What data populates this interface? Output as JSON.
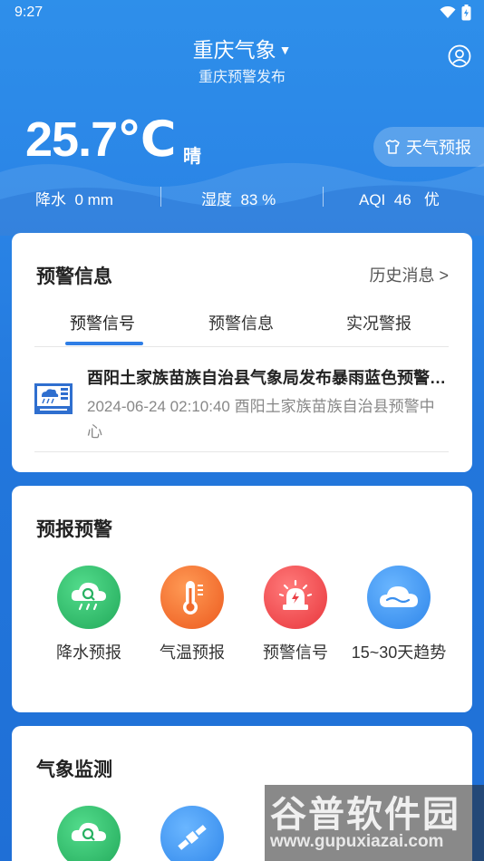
{
  "status_bar": {
    "time": "9:27"
  },
  "header": {
    "city": "重庆气象",
    "subtitle": "重庆预警发布"
  },
  "current": {
    "temperature": "25.7℃",
    "condition": "晴",
    "forecast_button": "天气预报",
    "stats": [
      {
        "label": "降水",
        "value": "0 mm"
      },
      {
        "label": "湿度",
        "value": "83 %"
      },
      {
        "label": "AQI",
        "value": "46",
        "level": "优"
      }
    ]
  },
  "warning_card": {
    "title": "预警信息",
    "history_link": "历史消息 >",
    "tabs": [
      "预警信号",
      "预警信息",
      "实况警报"
    ],
    "active_tab": 0,
    "items": [
      {
        "title": "酉阳土家族苗族自治县气象局发布暴雨蓝色预警信号",
        "meta": "2024-06-24 02:10:40    酉阳土家族苗族自治县预警中心",
        "icon": "rainstorm-blue-warning-icon"
      }
    ]
  },
  "forecast_card": {
    "title": "预报预警",
    "items": [
      {
        "label": "降水预报",
        "icon": "rain-forecast-icon",
        "color": "#2fbf6a"
      },
      {
        "label": "气温预报",
        "icon": "thermometer-icon",
        "color": "#f26b2a"
      },
      {
        "label": "预警信号",
        "icon": "alarm-light-icon",
        "color": "#f0454a"
      },
      {
        "label": "15~30天趋势",
        "icon": "cloud-icon",
        "color": "#3c93ef"
      }
    ]
  },
  "monitor_card": {
    "title": "气象监测",
    "items": [
      {
        "icon": "rain-monitor-icon",
        "color": "#2fbf6a"
      },
      {
        "icon": "satellite-icon",
        "color": "#3c93ef"
      }
    ]
  },
  "watermark": {
    "text": "谷普软件园",
    "url": "www.gupuxiazai.com"
  }
}
